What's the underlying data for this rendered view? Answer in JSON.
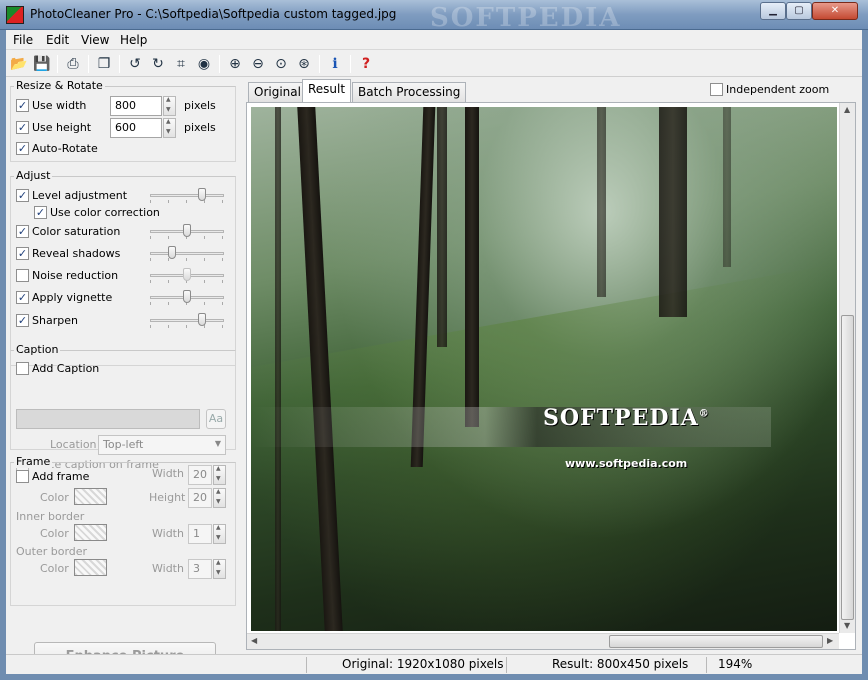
{
  "window": {
    "title": "PhotoCleaner Pro - C:\\Softpedia\\Softpedia custom tagged.jpg",
    "watermark": "SOFTPEDIA",
    "min_glyph": "▁",
    "max_glyph": "▢",
    "close_glyph": "✕"
  },
  "menu": [
    "File",
    "Edit",
    "View",
    "Help"
  ],
  "toolbar": {
    "icons": [
      "open-icon",
      "save-icon",
      "print-icon",
      "copy-icon",
      "rotate-left-icon",
      "rotate-right-icon",
      "crop-icon",
      "red-eye-icon",
      "zoom-in-icon",
      "zoom-out-icon",
      "zoom-fit-icon",
      "zoom-actual-icon",
      "info-icon",
      "help-icon"
    ],
    "info_glyph": "i",
    "help_glyph": "?"
  },
  "resize": {
    "title": "Resize & Rotate",
    "use_width_label": "Use width",
    "use_width_checked": true,
    "width_value": "800",
    "use_height_label": "Use height",
    "use_height_checked": true,
    "height_value": "600",
    "unit": "pixels",
    "auto_rotate_label": "Auto-Rotate",
    "auto_rotate_checked": true
  },
  "adjust": {
    "title": "Adjust",
    "items": [
      {
        "label": "Level adjustment",
        "checked": true,
        "slider": 0.72
      },
      {
        "label": "Use color correction",
        "checked": true
      },
      {
        "label": "Color saturation",
        "checked": true,
        "slider": 0.5
      },
      {
        "label": "Reveal shadows",
        "checked": true,
        "slider": 0.27
      },
      {
        "label": "Noise reduction",
        "checked": false,
        "slider": 0.5
      },
      {
        "label": "Apply vignette",
        "checked": true,
        "slider": 0.5
      },
      {
        "label": "Sharpen",
        "checked": true,
        "slider": 0.72
      }
    ]
  },
  "caption": {
    "title": "Caption",
    "add_caption_label": "Add Caption",
    "font_button": "Aa",
    "location_label": "Location",
    "location_value": "Top-left",
    "place_on_frame_label": "Place caption on frame"
  },
  "frame": {
    "title": "Frame",
    "add_frame_label": "Add frame",
    "color_label": "Color",
    "width_label": "Width",
    "height_label": "Height",
    "frame_width": "20",
    "frame_height": "20",
    "inner_border_label": "Inner border",
    "inner_width": "1",
    "outer_border_label": "Outer border",
    "outer_width": "3"
  },
  "enhance_button": "Enhance Picture",
  "tabs": [
    "Original",
    "Result",
    "Batch Processing"
  ],
  "active_tab": "Result",
  "independent_zoom_label": "Independent zoom",
  "image_watermark": {
    "logo": "SOFTPEDIA",
    "logo_mark": "®",
    "url": "www.softpedia.com"
  },
  "status": {
    "original": "Original: 1920x1080 pixels",
    "result": "Result: 800x450 pixels",
    "zoom": "194%"
  }
}
